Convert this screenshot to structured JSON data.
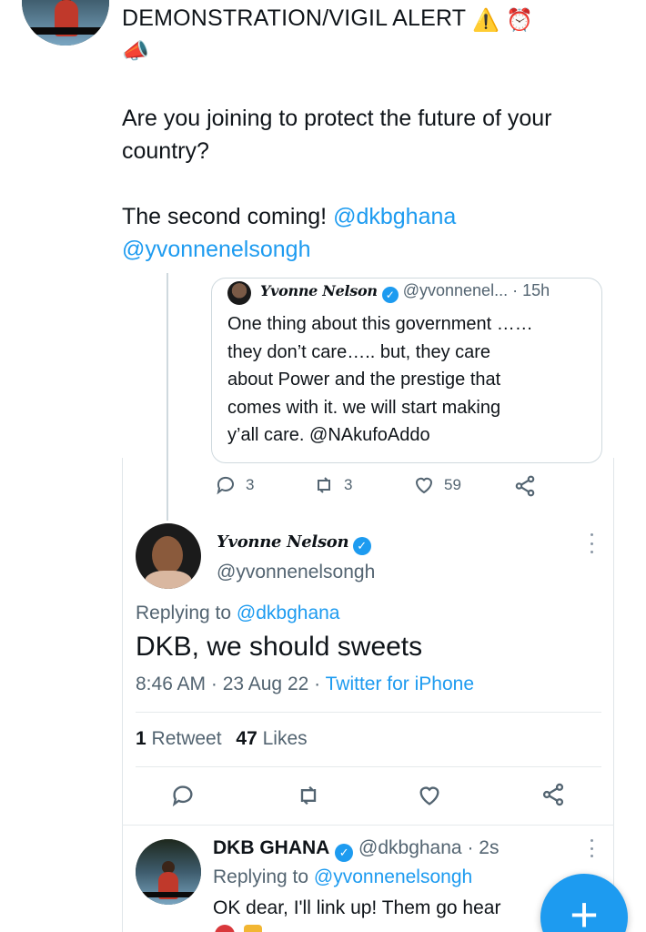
{
  "post": {
    "line1": "DEMONSTRATION/VIGIL ALERT",
    "warning_emoji": "⚠️",
    "alarm_emoji": "⏰",
    "megaphone_emoji": "📣",
    "para1": "Are you joining to protect the future of your country?",
    "para2_text": "The second coming!",
    "mention1": "@dkbghana",
    "mention2": "@yvonnenelsongh"
  },
  "quoted": {
    "display_name": "Yvonne Nelson",
    "handle": "@yvonnenel...",
    "time": "· 15h",
    "text_lines": [
      "One thing about this government ……",
      "they don’t care….. but, they care",
      "about Power and the prestige that",
      "comes with it. we will start making",
      "y’all care. @NAkufoAddo"
    ],
    "replies": "3",
    "retweets": "3",
    "likes": "59"
  },
  "main": {
    "display_name": "Yvonne Nelson",
    "handle": "@yvonnenelsongh",
    "replying_prefix": "Replying to",
    "replying_to": "@dkbghana",
    "text": "DKB, we should sweets",
    "time": "8:46 AM · 23 Aug 22 ·",
    "source": "Twitter for iPhone",
    "retweet_count": "1",
    "retweet_label": "Retweet",
    "like_count": "47",
    "like_label": "Likes"
  },
  "reply": {
    "display_name": "DKB GHANA",
    "handle": "@dkbghana",
    "time": "· 2s",
    "replying_prefix": "Replying to",
    "replying_to": "@yvonnenelsongh",
    "text": "OK dear, I'll link up! Them go hear"
  },
  "fab_label": "+",
  "colors": {
    "accent": "#1d9bf0",
    "text": "#0f1419",
    "muted": "#536471",
    "border": "#cfd9de"
  }
}
